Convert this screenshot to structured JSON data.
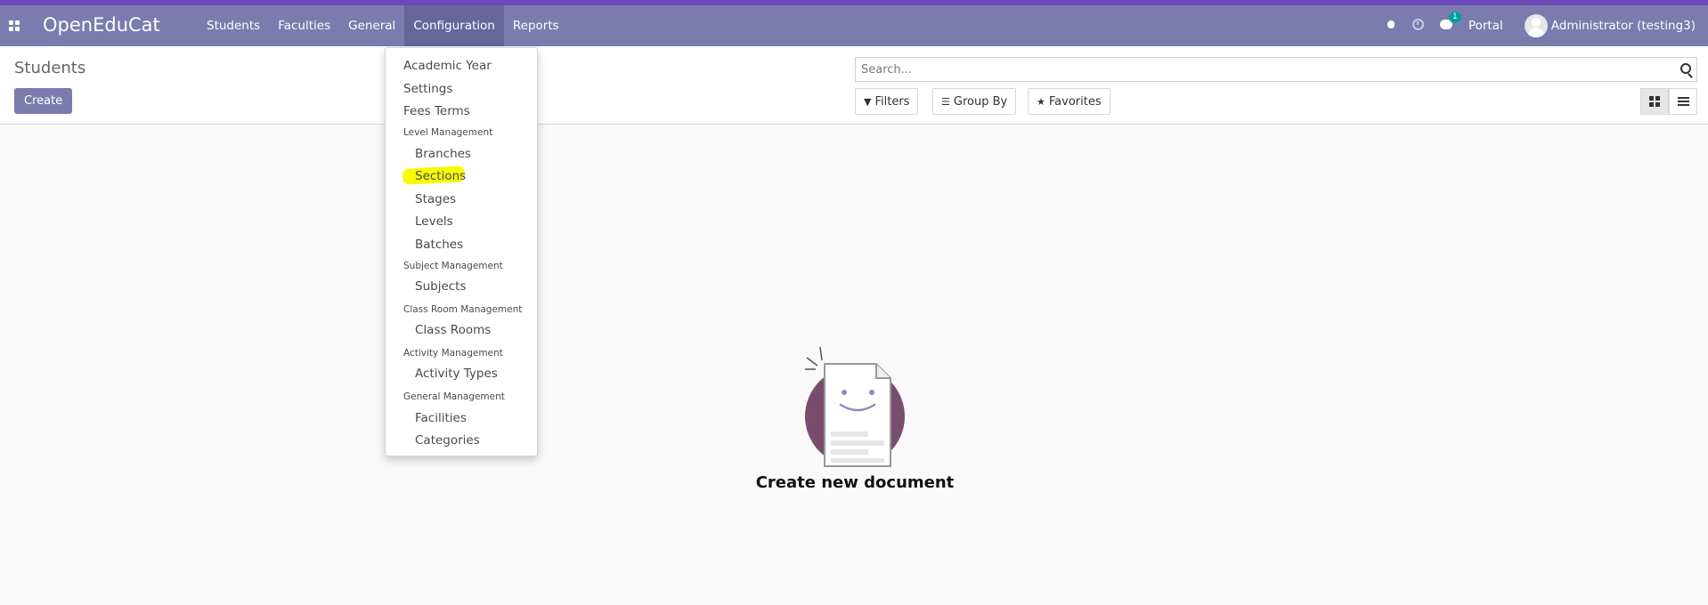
{
  "navbar": {
    "brand": "OpenEduCat",
    "menu": [
      "Students",
      "Faculties",
      "General",
      "Configuration",
      "Reports"
    ],
    "active_menu": "Configuration",
    "chat_badge": "1",
    "portal": "Portal",
    "user": "Administrator (testing3)"
  },
  "control": {
    "breadcrumb": "Students",
    "create_label": "Create",
    "search_placeholder": "Search...",
    "filters_label": "Filters",
    "groupby_label": "Group By",
    "favorites_label": "Favorites"
  },
  "dropdown": {
    "items": [
      {
        "type": "item",
        "label": "Academic Year"
      },
      {
        "type": "item",
        "label": "Settings"
      },
      {
        "type": "item",
        "label": "Fees Terms"
      },
      {
        "type": "header",
        "label": "Level Management"
      },
      {
        "type": "sub",
        "label": "Branches"
      },
      {
        "type": "sub",
        "label": "Sections",
        "highlighted": true
      },
      {
        "type": "sub",
        "label": "Stages"
      },
      {
        "type": "sub",
        "label": "Levels"
      },
      {
        "type": "sub",
        "label": "Batches"
      },
      {
        "type": "header",
        "label": "Subject Management"
      },
      {
        "type": "sub",
        "label": "Subjects"
      },
      {
        "type": "header",
        "label": "Class Room Management"
      },
      {
        "type": "sub",
        "label": "Class Rooms"
      },
      {
        "type": "header",
        "label": "Activity Management"
      },
      {
        "type": "sub",
        "label": "Activity Types"
      },
      {
        "type": "header",
        "label": "General Management"
      },
      {
        "type": "sub",
        "label": "Facilities"
      },
      {
        "type": "sub",
        "label": "Categories"
      }
    ]
  },
  "empty_state": {
    "title": "Create new document"
  },
  "colors": {
    "navbar": "#7c7bad",
    "accent_strip": "#6a4ab8",
    "highlight": "#f8fb05"
  }
}
